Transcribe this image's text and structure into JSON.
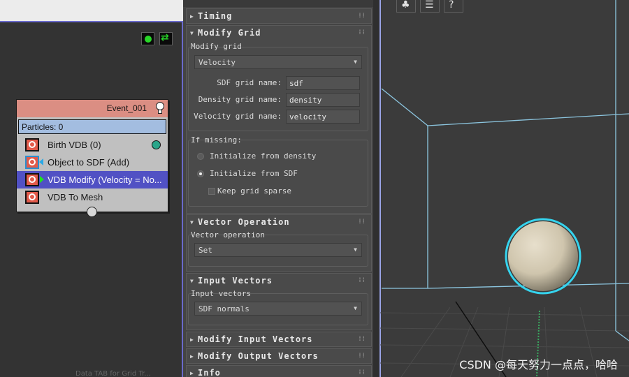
{
  "graph": {
    "event": {
      "title": "Event_001",
      "particles": "Particles: 0",
      "operators": [
        {
          "label": "Birth VDB (0)"
        },
        {
          "label": "Object to SDF (Add)"
        },
        {
          "label": "VDB Modify (Velocity = No..."
        },
        {
          "label": "VDB To Mesh"
        }
      ]
    },
    "faint_text": "Data TAB for Grid Tr..."
  },
  "panel": {
    "rollouts": {
      "timing": "Timing",
      "modify_grid": "Modify Grid",
      "vector_operation": "Vector Operation",
      "input_vectors": "Input Vectors",
      "modify_input_vectors": "Modify Input Vectors",
      "modify_output_vectors": "Modify Output Vectors",
      "info": "Info"
    },
    "modify_grid": {
      "group_label": "Modify grid",
      "mode_value": "Velocity",
      "sdf_label": "SDF grid name:",
      "sdf_value": "sdf",
      "density_label": "Density grid name:",
      "density_value": "density",
      "velocity_label": "Velocity grid name:",
      "velocity_value": "velocity",
      "missing_label": "If missing:",
      "opt_density": "Initialize from density",
      "opt_sdf": "Initialize from SDF",
      "opt_sparse": "Keep grid sparse",
      "selected_option": "Initialize from SDF"
    },
    "vector_operation": {
      "label": "Vector operation",
      "value": "Set"
    },
    "input_vectors": {
      "label": "Input vectors",
      "value": "SDF normals"
    }
  },
  "viewport": {
    "watermark": "CSDN @每天努力一点点，哈哈",
    "icons": [
      "tree-icon",
      "list-icon",
      "help-icon"
    ],
    "colors": {
      "sphere_outline": "#35d4ee",
      "grid_lines": "#8cc6e0",
      "velocity_line": "#3aa860"
    }
  }
}
